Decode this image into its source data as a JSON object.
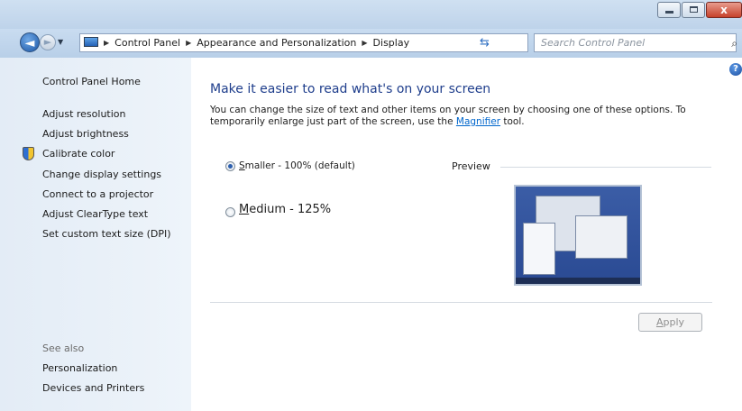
{
  "window": {
    "close_glyph": "x"
  },
  "nav": {
    "back_glyph": "◄",
    "forward_glyph": "►",
    "breadcrumbs": [
      "Control Panel",
      "Appearance and Personalization",
      "Display"
    ],
    "search_placeholder": "Search Control Panel"
  },
  "sidebar": {
    "home": "Control Panel Home",
    "items": [
      "Adjust resolution",
      "Adjust brightness",
      "Calibrate color",
      "Change display settings",
      "Connect to a projector",
      "Adjust ClearType text",
      "Set custom text size (DPI)"
    ],
    "see_also": "See also",
    "see_also_items": [
      "Personalization",
      "Devices and Printers"
    ]
  },
  "main": {
    "heading": "Make it easier to read what's on your screen",
    "desc_before": "You can change the size of text and other items on your screen by choosing one of these options. To temporarily enlarge just part of the screen, use the ",
    "desc_link": "Magnifier",
    "desc_after": " tool.",
    "options": [
      {
        "hotkey": "S",
        "rest": "maller - 100% (default)",
        "selected": true
      },
      {
        "hotkey": "M",
        "rest": "edium - 125%",
        "selected": false
      }
    ],
    "preview_label": "Preview",
    "apply_hotkey": "A",
    "apply_rest": "pply"
  }
}
